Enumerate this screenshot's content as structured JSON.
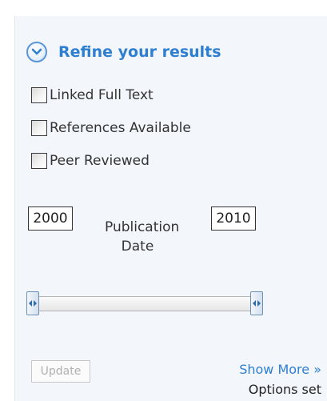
{
  "refine": {
    "title": "Refine your results",
    "toggle_icon": "chevron-down-circle-icon",
    "accent_color": "#2f7fd1"
  },
  "filters": [
    {
      "label": "Linked Full Text",
      "checked": false
    },
    {
      "label": "References Available",
      "checked": false
    },
    {
      "label": "Peer Reviewed",
      "checked": false
    }
  ],
  "date_range": {
    "from_year": "2000",
    "to_year": "2010",
    "label_line1": "Publication",
    "label_line2": "Date",
    "slider_min_fraction": 0.0,
    "slider_max_fraction": 1.0
  },
  "actions": {
    "update_label": "Update",
    "update_enabled": false,
    "show_more_label": "Show More »",
    "options_status": "Options set"
  }
}
